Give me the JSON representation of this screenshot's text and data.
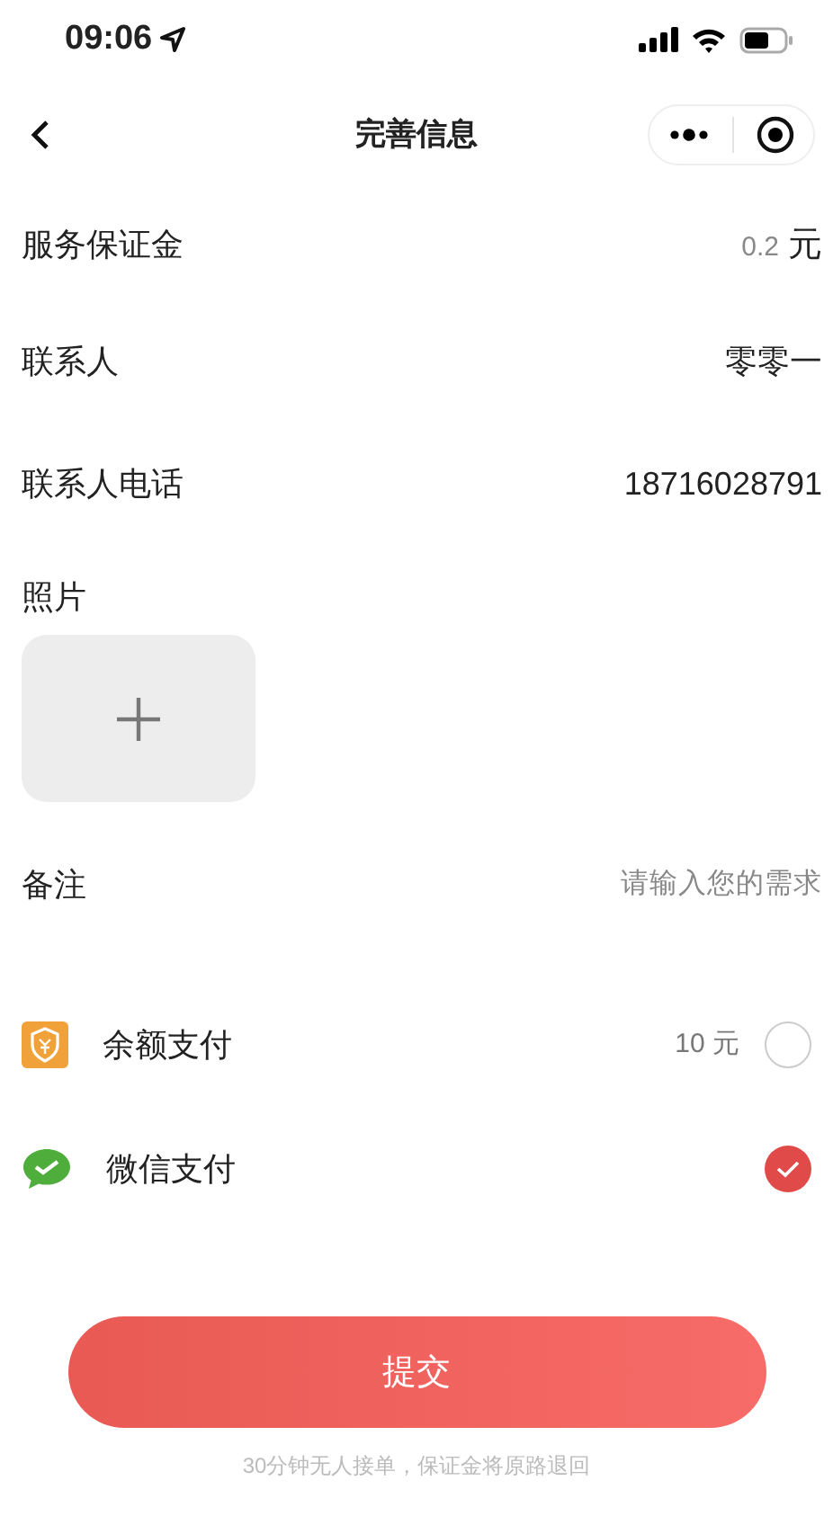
{
  "status_bar": {
    "time": "09:06"
  },
  "nav": {
    "title": "完善信息"
  },
  "fields": [
    {
      "label": "服务保证金",
      "amount": "0.2",
      "unit": "元"
    },
    {
      "label": "联系人",
      "value": "零零一"
    },
    {
      "label": "联系人电话",
      "value": "18716028791"
    }
  ],
  "photo": {
    "label": "照片"
  },
  "notes": {
    "label": "备注",
    "placeholder": "请输入您的需求"
  },
  "payments": [
    {
      "kind": "balance",
      "label": "余额支付",
      "balance": "10 元",
      "selected": false
    },
    {
      "kind": "wechat",
      "label": "微信支付",
      "selected": true
    }
  ],
  "submit": {
    "label": "提交",
    "note": "30分钟无人接单，保证金将原路退回"
  }
}
